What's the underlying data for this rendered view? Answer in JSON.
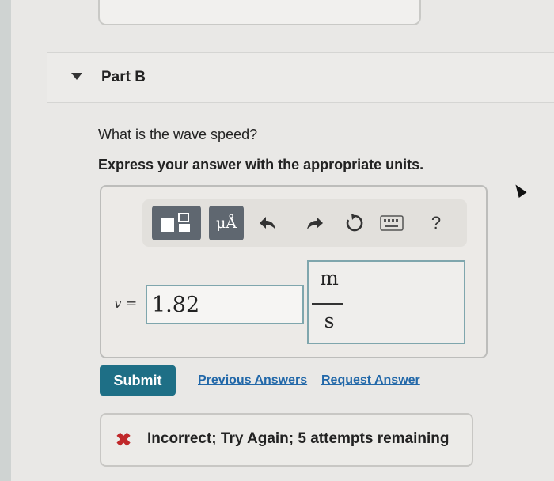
{
  "part": {
    "title": "Part B"
  },
  "question": {
    "prompt": "What is the wave speed?",
    "instruction": "Express your answer with the appropriate units."
  },
  "toolbar": {
    "units_label": "μÅ",
    "undo_icon": "undo-arrow-icon",
    "redo_icon": "redo-arrow-icon",
    "reset_icon": "reset-icon",
    "keyboard_icon": "keyboard-icon",
    "help_label": "?"
  },
  "answer": {
    "variable": "v =",
    "value": "1.82",
    "unit_numerator": "m",
    "unit_denominator": "s"
  },
  "actions": {
    "submit": "Submit",
    "previous_answers": "Previous Answers",
    "request_answer": "Request Answer"
  },
  "feedback": {
    "icon": "✖",
    "message": "Incorrect; Try Again; 5 attempts remaining",
    "color": "#c0282a"
  },
  "colors": {
    "accent": "#1e6f86",
    "link": "#2268a9",
    "input_border": "#7fa6ad"
  }
}
